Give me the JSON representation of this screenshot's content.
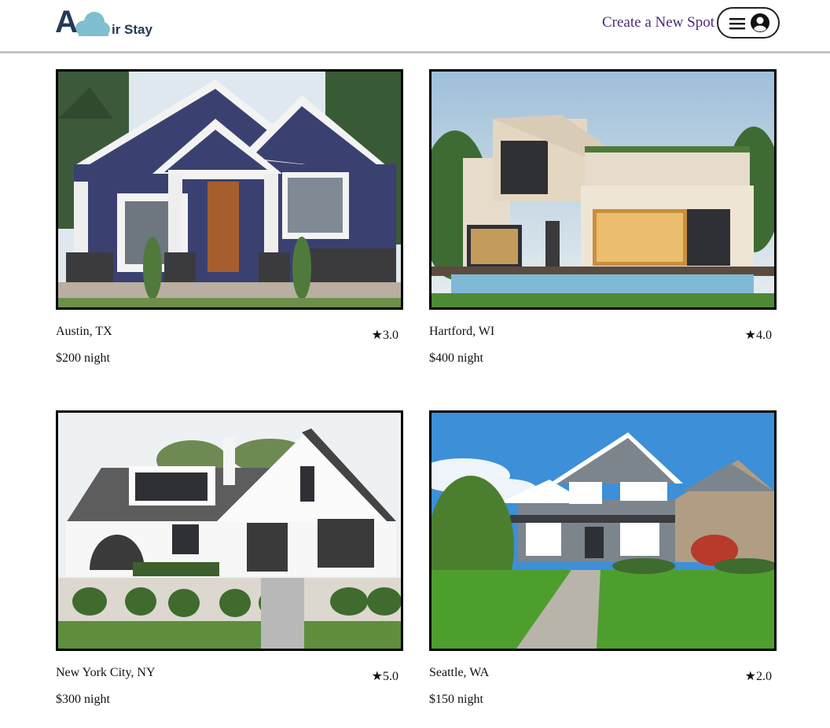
{
  "header": {
    "logo_letter": "A",
    "logo_text": "ir Stay",
    "create_label": "Create a New Spot",
    "menu_icon": "hamburger-icon",
    "profile_icon": "user-circle-icon"
  },
  "spots": [
    {
      "location": "Austin, TX",
      "rating": "★3.0",
      "price": "$200 night"
    },
    {
      "location": "Hartford, WI",
      "rating": "★4.0",
      "price": "$400 night"
    },
    {
      "location": "New York City, NY",
      "rating": "★5.0",
      "price": "$300 night"
    },
    {
      "location": "Seattle, WA",
      "rating": "★2.0",
      "price": "$150 night"
    }
  ],
  "colors": {
    "brand_dark": "#243a57",
    "brand_cloud": "#7fbfcf",
    "link": "#4b2a7a",
    "divider": "#c4c4c4"
  }
}
